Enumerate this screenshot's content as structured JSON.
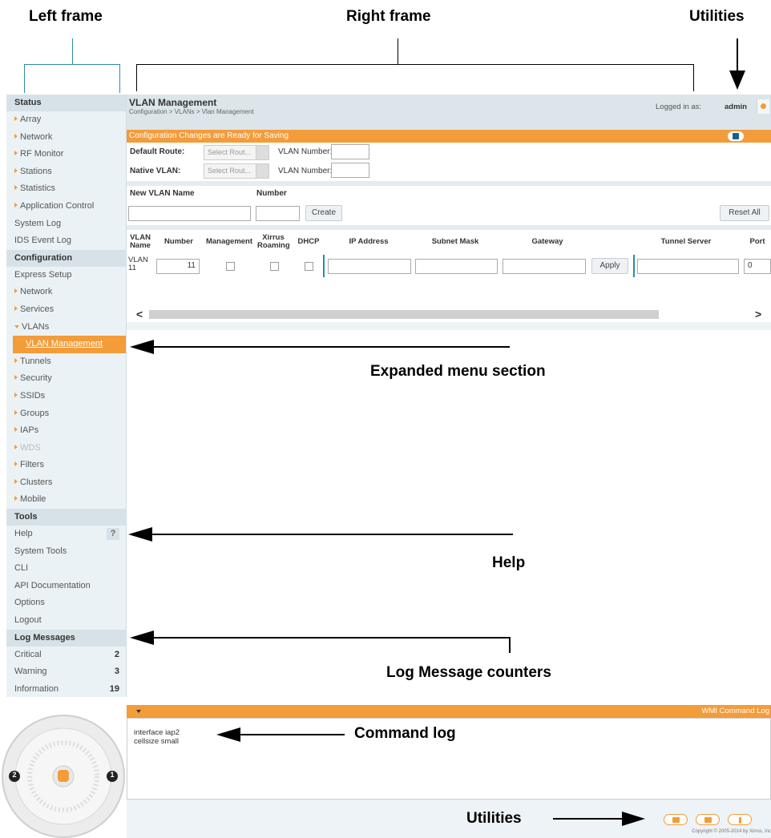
{
  "annotations": {
    "left_frame": "Left frame",
    "right_frame": "Right frame",
    "utilities_top": "Utilities",
    "expanded_menu": "Expanded menu section",
    "help": "Help",
    "log_counters": "Log Message counters",
    "command_log": "Command log",
    "utilities_bottom": "Utilities"
  },
  "sidebar": {
    "status_header": "Status",
    "status_items": [
      "Array",
      "Network",
      "RF Monitor",
      "Stations",
      "Statistics",
      "Application Control",
      "System Log",
      "IDS Event Log"
    ],
    "configuration_header": "Configuration",
    "config_items": [
      "Express Setup",
      "Network",
      "Services",
      "VLANs",
      "VLAN Management",
      "Tunnels",
      "Security",
      "SSIDs",
      "Groups",
      "IAPs",
      "WDS",
      "Filters",
      "Clusters",
      "Mobile"
    ],
    "tools_header": "Tools",
    "tools_items": [
      "Help",
      "System Tools",
      "CLI",
      "API Documentation",
      "Options",
      "Logout"
    ],
    "help_badge": "?",
    "log_header": "Log Messages",
    "log_items": [
      {
        "label": "Critical",
        "count": "2"
      },
      {
        "label": "Warning",
        "count": "3"
      },
      {
        "label": "Information",
        "count": "19"
      }
    ],
    "ap_port_left": "2",
    "ap_port_right": "1"
  },
  "header": {
    "title": "VLAN Management",
    "breadcrumb": "Configuration > VLANs > Vlan Management",
    "logged_in_label": "Logged in as:",
    "user": "admin"
  },
  "banner": {
    "text": "Configuration Changes are Ready for Saving"
  },
  "form": {
    "default_route_label": "Default Route:",
    "native_vlan_label": "Native VLAN:",
    "select_placeholder": "Select Rout...",
    "vlan_number_label": "VLAN Number:",
    "new_vlan_name_label": "New VLAN Name",
    "number_label": "Number",
    "create_button": "Create",
    "reset_button": "Reset All"
  },
  "table": {
    "headers": [
      "VLAN Name",
      "Number",
      "Management",
      "Xirrus Roaming",
      "DHCP",
      "IP Address",
      "Subnet Mask",
      "Gateway",
      "Tunnel Server",
      "Port"
    ],
    "row": {
      "name": "VLAN 11",
      "number": "11",
      "apply": "Apply",
      "port": "0"
    }
  },
  "command_log": {
    "title": "WMI Command Log",
    "lines": [
      "interface iap2",
      "cellsize small"
    ]
  },
  "footer": {
    "copyright": "Copyright © 2005-2014 by Xirrus, Inc"
  },
  "colors": {
    "accent": "#f39c3a",
    "frame_bg": "#ebf2f5",
    "header_bg": "#dbe5ea"
  }
}
